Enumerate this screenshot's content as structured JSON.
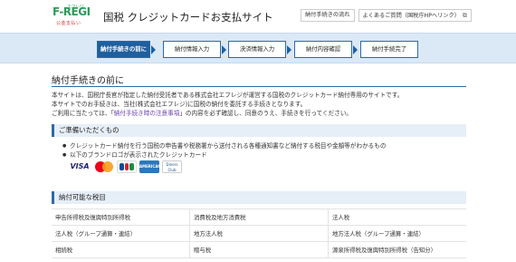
{
  "header": {
    "logo_text": "F-REGI",
    "logo_sup": "エフレジ",
    "logo_sub": "公金支払い",
    "site_title": "国税 クレジットカードお支払サイト",
    "links": [
      {
        "label": "納付手続きの流れ"
      },
      {
        "label": "よくあるご質問（国税庁HPへリンク）"
      }
    ]
  },
  "steps": [
    {
      "label": "納付手続きの前に",
      "active": true
    },
    {
      "label": "納付情報入力",
      "active": false
    },
    {
      "label": "決済情報入力",
      "active": false
    },
    {
      "label": "納付内容確認",
      "active": false
    },
    {
      "label": "納付手続完了",
      "active": false
    }
  ],
  "main": {
    "title": "納付手続きの前に",
    "intro_line1": "本サイトは、国税庁長官が指定した納付受託者である株式会社エフレジが運営する国税のクレジットカード納付専用のサイトです。",
    "intro_line2": "本サイトでのお手続きは、当社(株式会社エフレジ)に国税の納付を委託する手続きとなります。",
    "intro_line3_before": "ご利用に当たっては、「",
    "intro_line3_link": "納付手続き時の注意事項",
    "intro_line3_after": "」の内容を必ず確認し、同意のうえ、手続きを行ってください。",
    "prep_heading": "ご準備いただくもの",
    "prep_items": [
      "クレジットカード納付を行う国税の申告書や税務署から送付される各種通知書など納付する税目や金額等がわかるもの",
      "以下のブランドロゴが表示されたクレジットカード"
    ],
    "card_brands": [
      "visa-logo",
      "mastercard-logo",
      "jcb-logo",
      "amex-logo",
      "diners-logo"
    ],
    "card_text": {
      "visa": "VISA",
      "amex": "AMERICAN EXPRESS",
      "diners": "Diners Club"
    },
    "tax_heading": "納付可能な税目",
    "tax_rows": [
      [
        "申告所得税及復興特別所得税",
        "消費税及地方消費税",
        "法人税"
      ],
      [
        "法人税（グループ通算・連結）",
        "地方法人税",
        "地方法人税（グループ通算・連結）"
      ],
      [
        "相続税",
        "贈与税",
        "源泉所得税及復興特別所得税（告知分）"
      ]
    ]
  },
  "colors": {
    "accent": "#1f5f9e",
    "steps_bg": "#dbe8f5",
    "section_bg": "#e6eef7",
    "link": "#6c3fb0",
    "brand_green": "#2f9a5b"
  }
}
